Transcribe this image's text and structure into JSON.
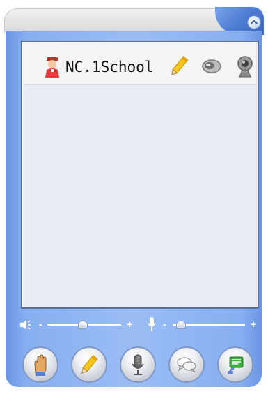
{
  "window": {
    "collapse_icon": "chevron-up-icon"
  },
  "user_list": {
    "users": [
      {
        "name": "NC.1School",
        "avatar_icon": "teacher-avatar-icon",
        "status_icons": [
          "pencil-icon",
          "speaker-icon",
          "webcam-icon"
        ]
      }
    ]
  },
  "audio_controls": {
    "speaker_volume": {
      "icon": "speaker-volume-icon",
      "minus": "-",
      "plus": "+",
      "level": 0.48
    },
    "mic_volume": {
      "icon": "microphone-volume-icon",
      "minus": "-",
      "plus": "+",
      "level": 0.12
    }
  },
  "toolbar": {
    "buttons": [
      {
        "icon": "raise-hand-icon"
      },
      {
        "icon": "pencil-icon"
      },
      {
        "icon": "microphone-icon"
      },
      {
        "icon": "chat-bubbles-icon"
      },
      {
        "icon": "message-board-icon"
      }
    ]
  },
  "colors": {
    "frame_blue": "#86aef0",
    "panel_bg": "#e7ebf3",
    "text": "#111111"
  }
}
